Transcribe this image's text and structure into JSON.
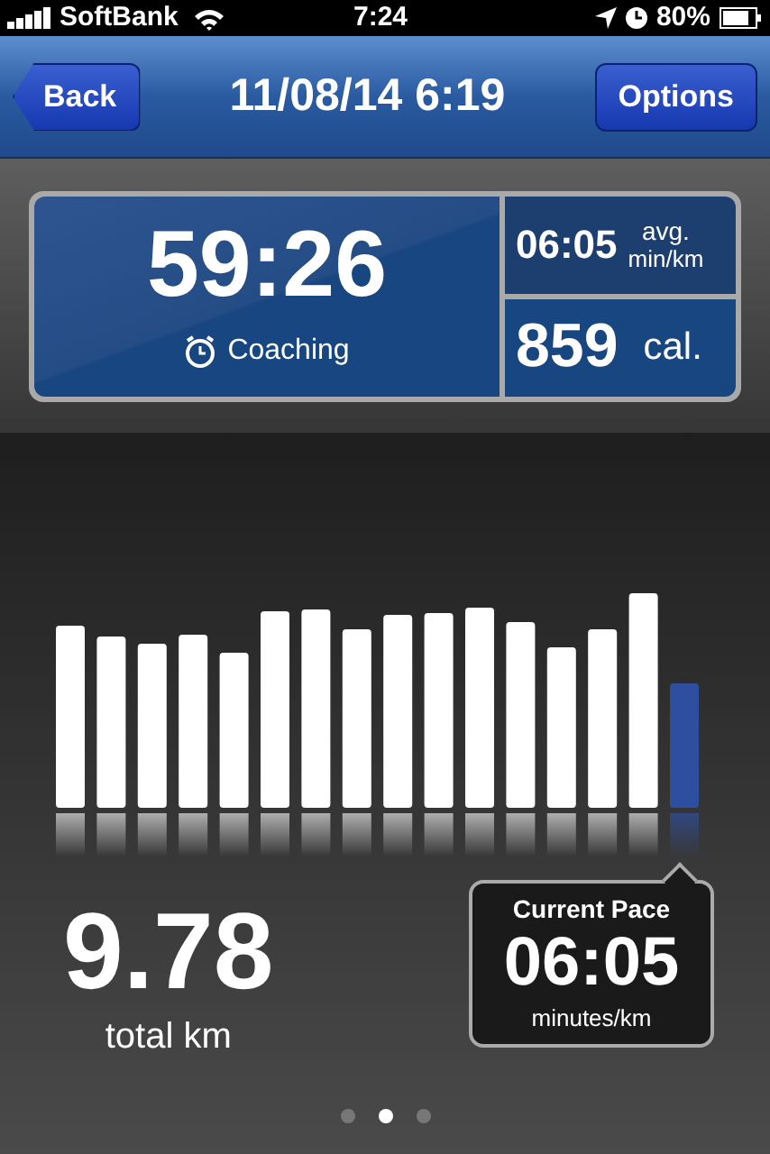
{
  "status_bar": {
    "carrier": "SoftBank",
    "time": "7:24",
    "battery": "80%"
  },
  "nav_bar": {
    "back": "Back",
    "title": "11/08/14 6:19",
    "options": "Options"
  },
  "summary": {
    "duration": "59:26",
    "mode": "Coaching",
    "avg_pace": "06:05",
    "avg_label_1": "avg.",
    "avg_label_2": "min/km",
    "calories": "859",
    "calories_unit": "cal."
  },
  "distance": {
    "value": "9.78",
    "unit": "total km"
  },
  "current_pace": {
    "title": "Current Pace",
    "value": "06:05",
    "unit": "minutes/km"
  },
  "pages": [
    {
      "selected": false
    },
    {
      "selected": true
    },
    {
      "selected": false
    }
  ]
}
